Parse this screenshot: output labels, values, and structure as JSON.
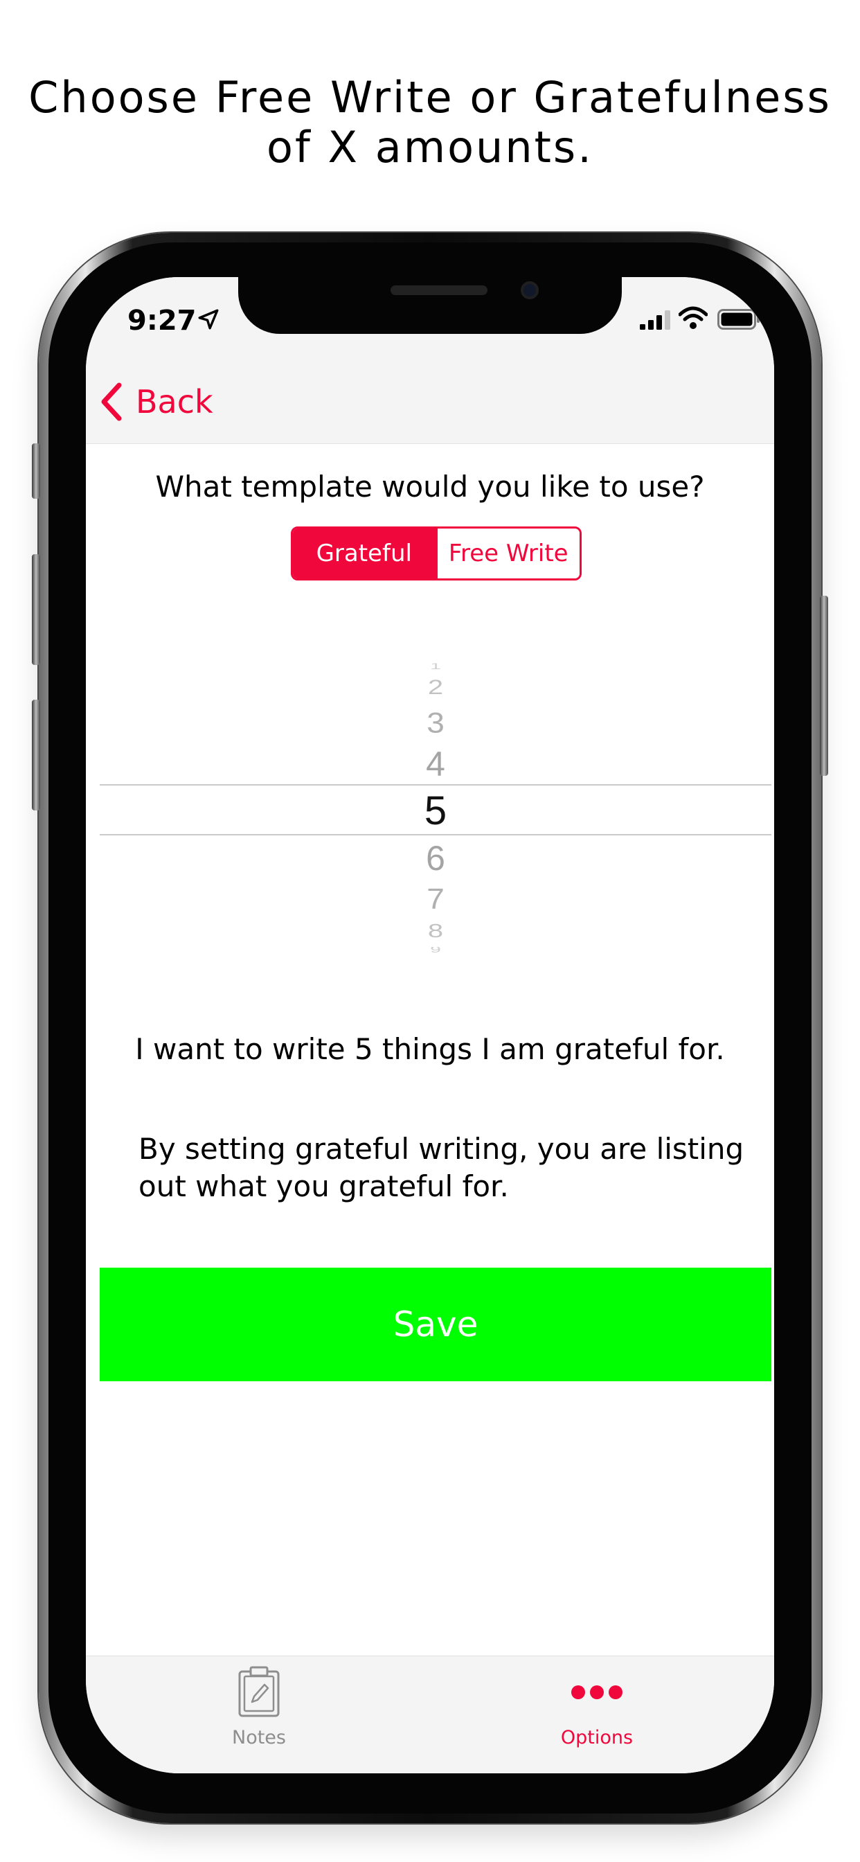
{
  "caption": {
    "line1": "Choose Free Write or Gratefulness",
    "line2": "of X amounts."
  },
  "status_bar": {
    "time": "9:27",
    "icons": [
      "location-arrow-icon",
      "cellular-signal-icon",
      "wifi-icon",
      "battery-icon"
    ]
  },
  "nav": {
    "back_label": "Back"
  },
  "template": {
    "question": "What template would you like to use?",
    "options": [
      "Grateful",
      "Free Write"
    ],
    "selected": "Grateful"
  },
  "picker": {
    "values": [
      "1",
      "2",
      "3",
      "4",
      "5",
      "6",
      "7",
      "8",
      "9"
    ],
    "selected": "5"
  },
  "summary": "I want to write 5 things I am grateful for.",
  "description": "By setting grateful writing, you are listing out what you grateful for.",
  "save_label": "Save",
  "tabs": [
    {
      "label": "Notes",
      "icon": "clipboard-icon",
      "active": false
    },
    {
      "label": "Options",
      "icon": "more-dots-icon",
      "active": true
    }
  ],
  "colors": {
    "accent": "#f0073b",
    "save": "#00ff00",
    "inactive_tab": "#8e8e8e",
    "bar_background": "#f4f4f4"
  }
}
